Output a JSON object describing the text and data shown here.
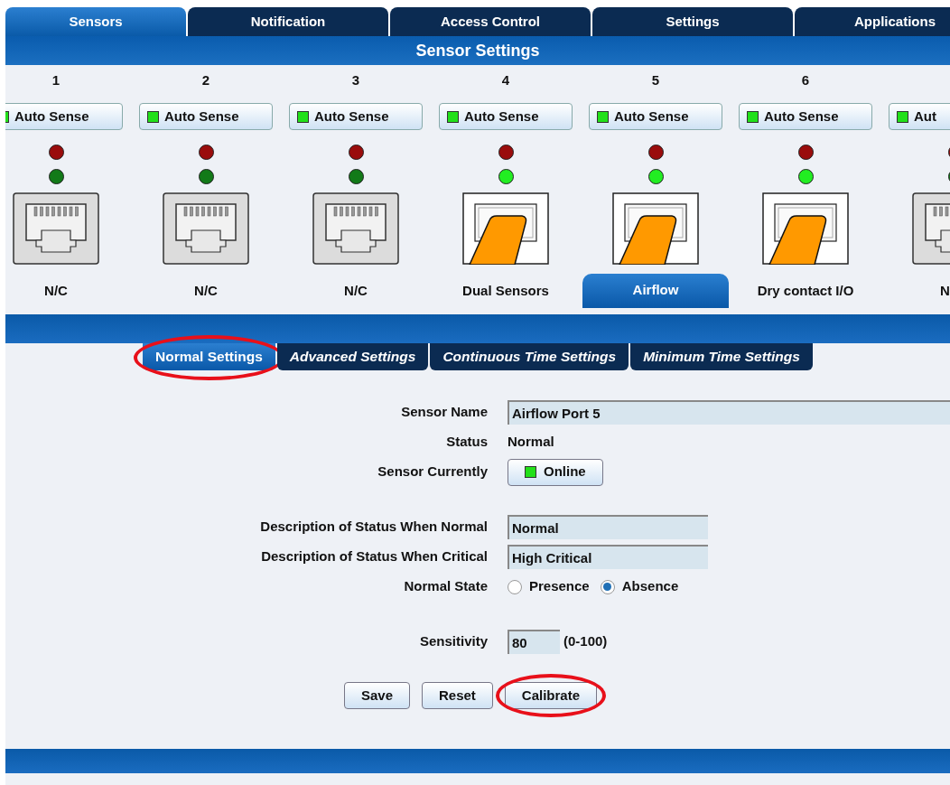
{
  "top_tabs": [
    {
      "label": "Sensors",
      "selected": true
    },
    {
      "label": "Notification",
      "selected": false
    },
    {
      "label": "Access Control",
      "selected": false
    },
    {
      "label": "Settings",
      "selected": false
    },
    {
      "label": "Applications",
      "selected": false
    }
  ],
  "title": "Sensor Settings",
  "ports": [
    {
      "number": "1",
      "auto_label": "Auto Sense",
      "red_on": false,
      "green_on": false,
      "kind": "empty",
      "label": "N/C",
      "selected": false
    },
    {
      "number": "2",
      "auto_label": "Auto Sense",
      "red_on": false,
      "green_on": false,
      "kind": "empty",
      "label": "N/C",
      "selected": false
    },
    {
      "number": "3",
      "auto_label": "Auto Sense",
      "red_on": false,
      "green_on": false,
      "kind": "empty",
      "label": "N/C",
      "selected": false
    },
    {
      "number": "4",
      "auto_label": "Auto Sense",
      "red_on": false,
      "green_on": true,
      "kind": "plugged",
      "label": "Dual Sensors",
      "selected": false
    },
    {
      "number": "5",
      "auto_label": "Auto Sense",
      "red_on": false,
      "green_on": true,
      "kind": "plugged",
      "label": "Airflow",
      "selected": true
    },
    {
      "number": "6",
      "auto_label": "Auto Sense",
      "red_on": false,
      "green_on": true,
      "kind": "plugged",
      "label": "Dry contact I/O",
      "selected": false
    },
    {
      "auto_label": "Aut",
      "red_on": false,
      "green_on": false,
      "kind": "empty",
      "label": "N",
      "selected": false
    }
  ],
  "sub_tabs": [
    {
      "label": "Normal Settings",
      "selected": true,
      "circled": true
    },
    {
      "label": "Advanced Settings",
      "selected": false,
      "circled": false
    },
    {
      "label": "Continuous Time Settings",
      "selected": false,
      "circled": false
    },
    {
      "label": "Minimum Time Settings",
      "selected": false,
      "circled": false
    }
  ],
  "form_groups": [
    [
      {
        "kind": "name_field",
        "label": "Sensor Name",
        "value": "Airflow Port 5"
      },
      {
        "kind": "text",
        "label": "Status",
        "value": "Normal"
      },
      {
        "kind": "status_button",
        "label": "Sensor Currently",
        "value": "Online",
        "indicator_on": true
      }
    ],
    [
      {
        "kind": "field",
        "label": "Description of Status When Normal",
        "value": "Normal"
      },
      {
        "kind": "field",
        "label": "Description of Status When Critical",
        "value": "High Critical"
      },
      {
        "kind": "radio",
        "label": "Normal State",
        "options": [
          {
            "label": "Presence",
            "selected": false
          },
          {
            "label": "Absence",
            "selected": true
          }
        ]
      }
    ],
    [
      {
        "kind": "number_field",
        "label": "Sensitivity",
        "value": "80",
        "hint": "(0-100)"
      }
    ]
  ],
  "buttons": [
    {
      "label": "Save",
      "circled": false
    },
    {
      "label": "Reset",
      "circled": false
    },
    {
      "label": "Calibrate",
      "circled": true
    }
  ]
}
